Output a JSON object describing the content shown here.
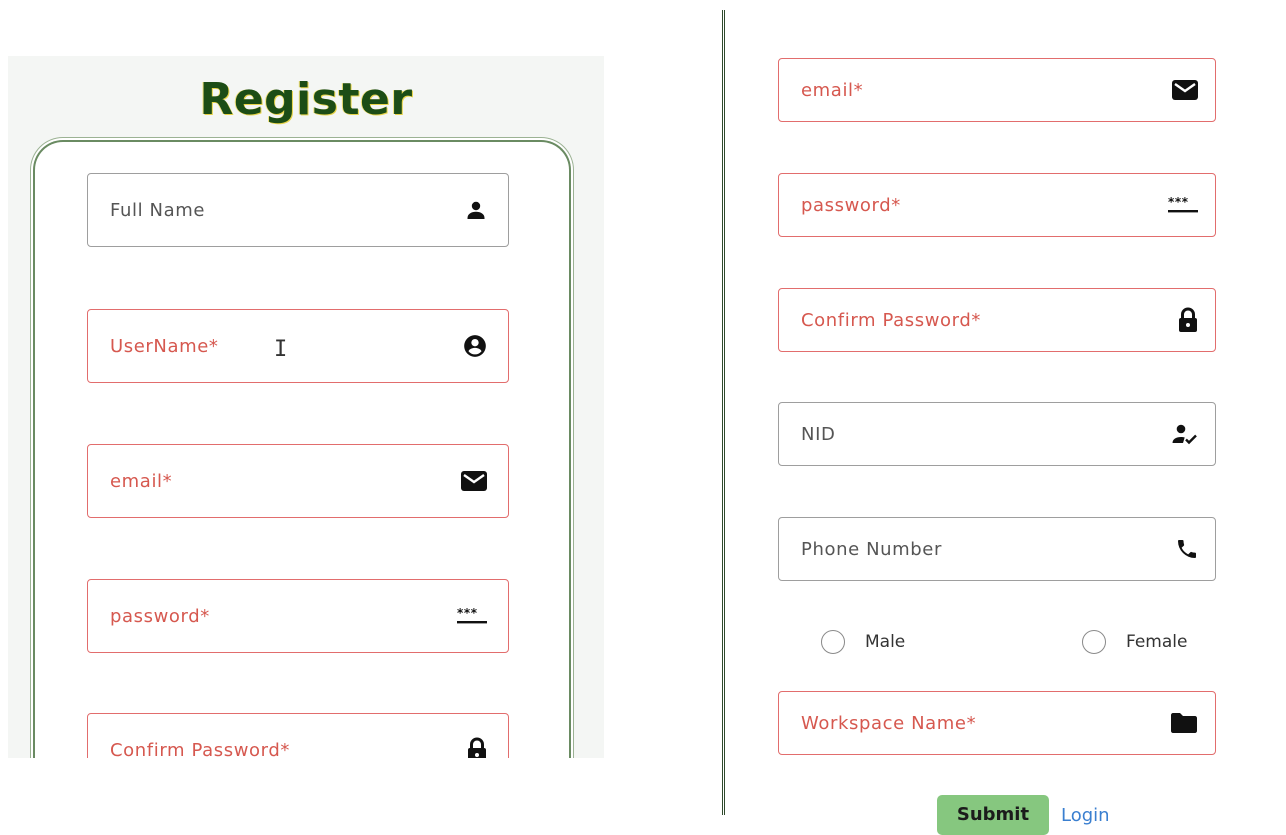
{
  "left": {
    "title": "Register",
    "fields": {
      "full_name": "Full Name",
      "username": "UserName*",
      "email": "email*",
      "password": "password*",
      "confirm_password": "Confirm Password*"
    },
    "icons": {
      "full_name": "person-icon",
      "username": "account-circle-icon",
      "email": "mail-icon",
      "password": "password-dots-icon",
      "confirm_password": "lock-icon"
    },
    "cursor": "I"
  },
  "right": {
    "fields": {
      "email": "email*",
      "password": "password*",
      "confirm_password": "Confirm Password*",
      "nid": "NID",
      "phone": "Phone Number",
      "workspace": "Workspace Name*"
    },
    "icons": {
      "email": "mail-icon",
      "password": "password-dots-icon",
      "confirm_password": "lock-icon",
      "nid": "person-check-icon",
      "phone": "phone-icon",
      "workspace": "folder-icon"
    },
    "gender": {
      "male": "Male",
      "female": "Female"
    },
    "submit_label": "Submit",
    "login_label": "Login"
  },
  "colors": {
    "title": "#1c4d16",
    "error": "#d6584f",
    "error_border": "#e26d6d",
    "submit_bg": "#86c77f",
    "link": "#3a7fd0"
  }
}
